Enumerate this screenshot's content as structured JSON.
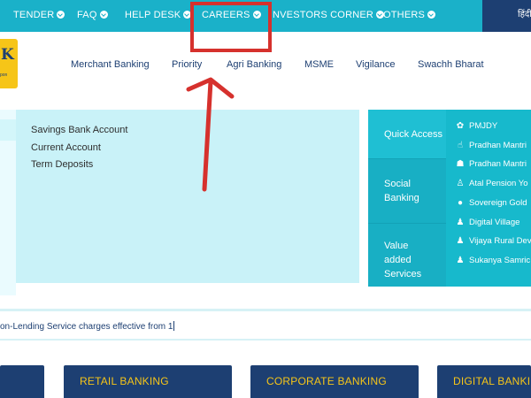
{
  "top_nav": {
    "items": [
      {
        "label": "TENDER"
      },
      {
        "label": "FAQ"
      },
      {
        "label": "HELP DESK"
      },
      {
        "label": "CAREERS"
      },
      {
        "label": "NVESTORS CORNER"
      },
      {
        "label": "OTHERS"
      }
    ],
    "language_toggle": "हिंदी"
  },
  "logo": {
    "letter": "K",
    "tagline": "pon"
  },
  "main_nav": {
    "items": [
      {
        "label": "Merchant Banking"
      },
      {
        "label": "Priority"
      },
      {
        "label": "Agri Banking"
      },
      {
        "label": "MSME"
      },
      {
        "label": "Vigilance"
      },
      {
        "label": "Swachh Bharat"
      }
    ]
  },
  "deposits": {
    "links": [
      {
        "label": "Savings Bank Account"
      },
      {
        "label": "Current Account"
      },
      {
        "label": "Term Deposits"
      }
    ]
  },
  "access_menu": {
    "items": [
      {
        "label": "Quick Access"
      },
      {
        "label": "Social Banking"
      },
      {
        "label": "Value added Services"
      }
    ]
  },
  "schemes": {
    "items": [
      {
        "label": "PMJDY",
        "icon": "lotus-icon"
      },
      {
        "label": "Pradhan Mantri",
        "icon": "hand-icon"
      },
      {
        "label": "Pradhan Mantri",
        "icon": "family-icon"
      },
      {
        "label": "Atal Pension Yo",
        "icon": "elderly-icon"
      },
      {
        "label": "Sovereign Gold",
        "icon": "coin-icon"
      },
      {
        "label": "Digital Village",
        "icon": "person-icon"
      },
      {
        "label": "Vijaya Rural Dev",
        "icon": "person-icon"
      },
      {
        "label": "Sukanya Samric",
        "icon": "person-icon"
      }
    ]
  },
  "ticker": {
    "text": "on-Lending Service charges effective from 1"
  },
  "banking_tiles": [
    {
      "label": ""
    },
    {
      "label": "RETAIL BANKING"
    },
    {
      "label": "CORPORATE BANKING"
    },
    {
      "label": "DIGITAL BANKING"
    }
  ],
  "colors": {
    "topbar": "#1ab1c9",
    "navy": "#1d3f72",
    "gold": "#f6c518",
    "annotation": "#d6312d"
  }
}
